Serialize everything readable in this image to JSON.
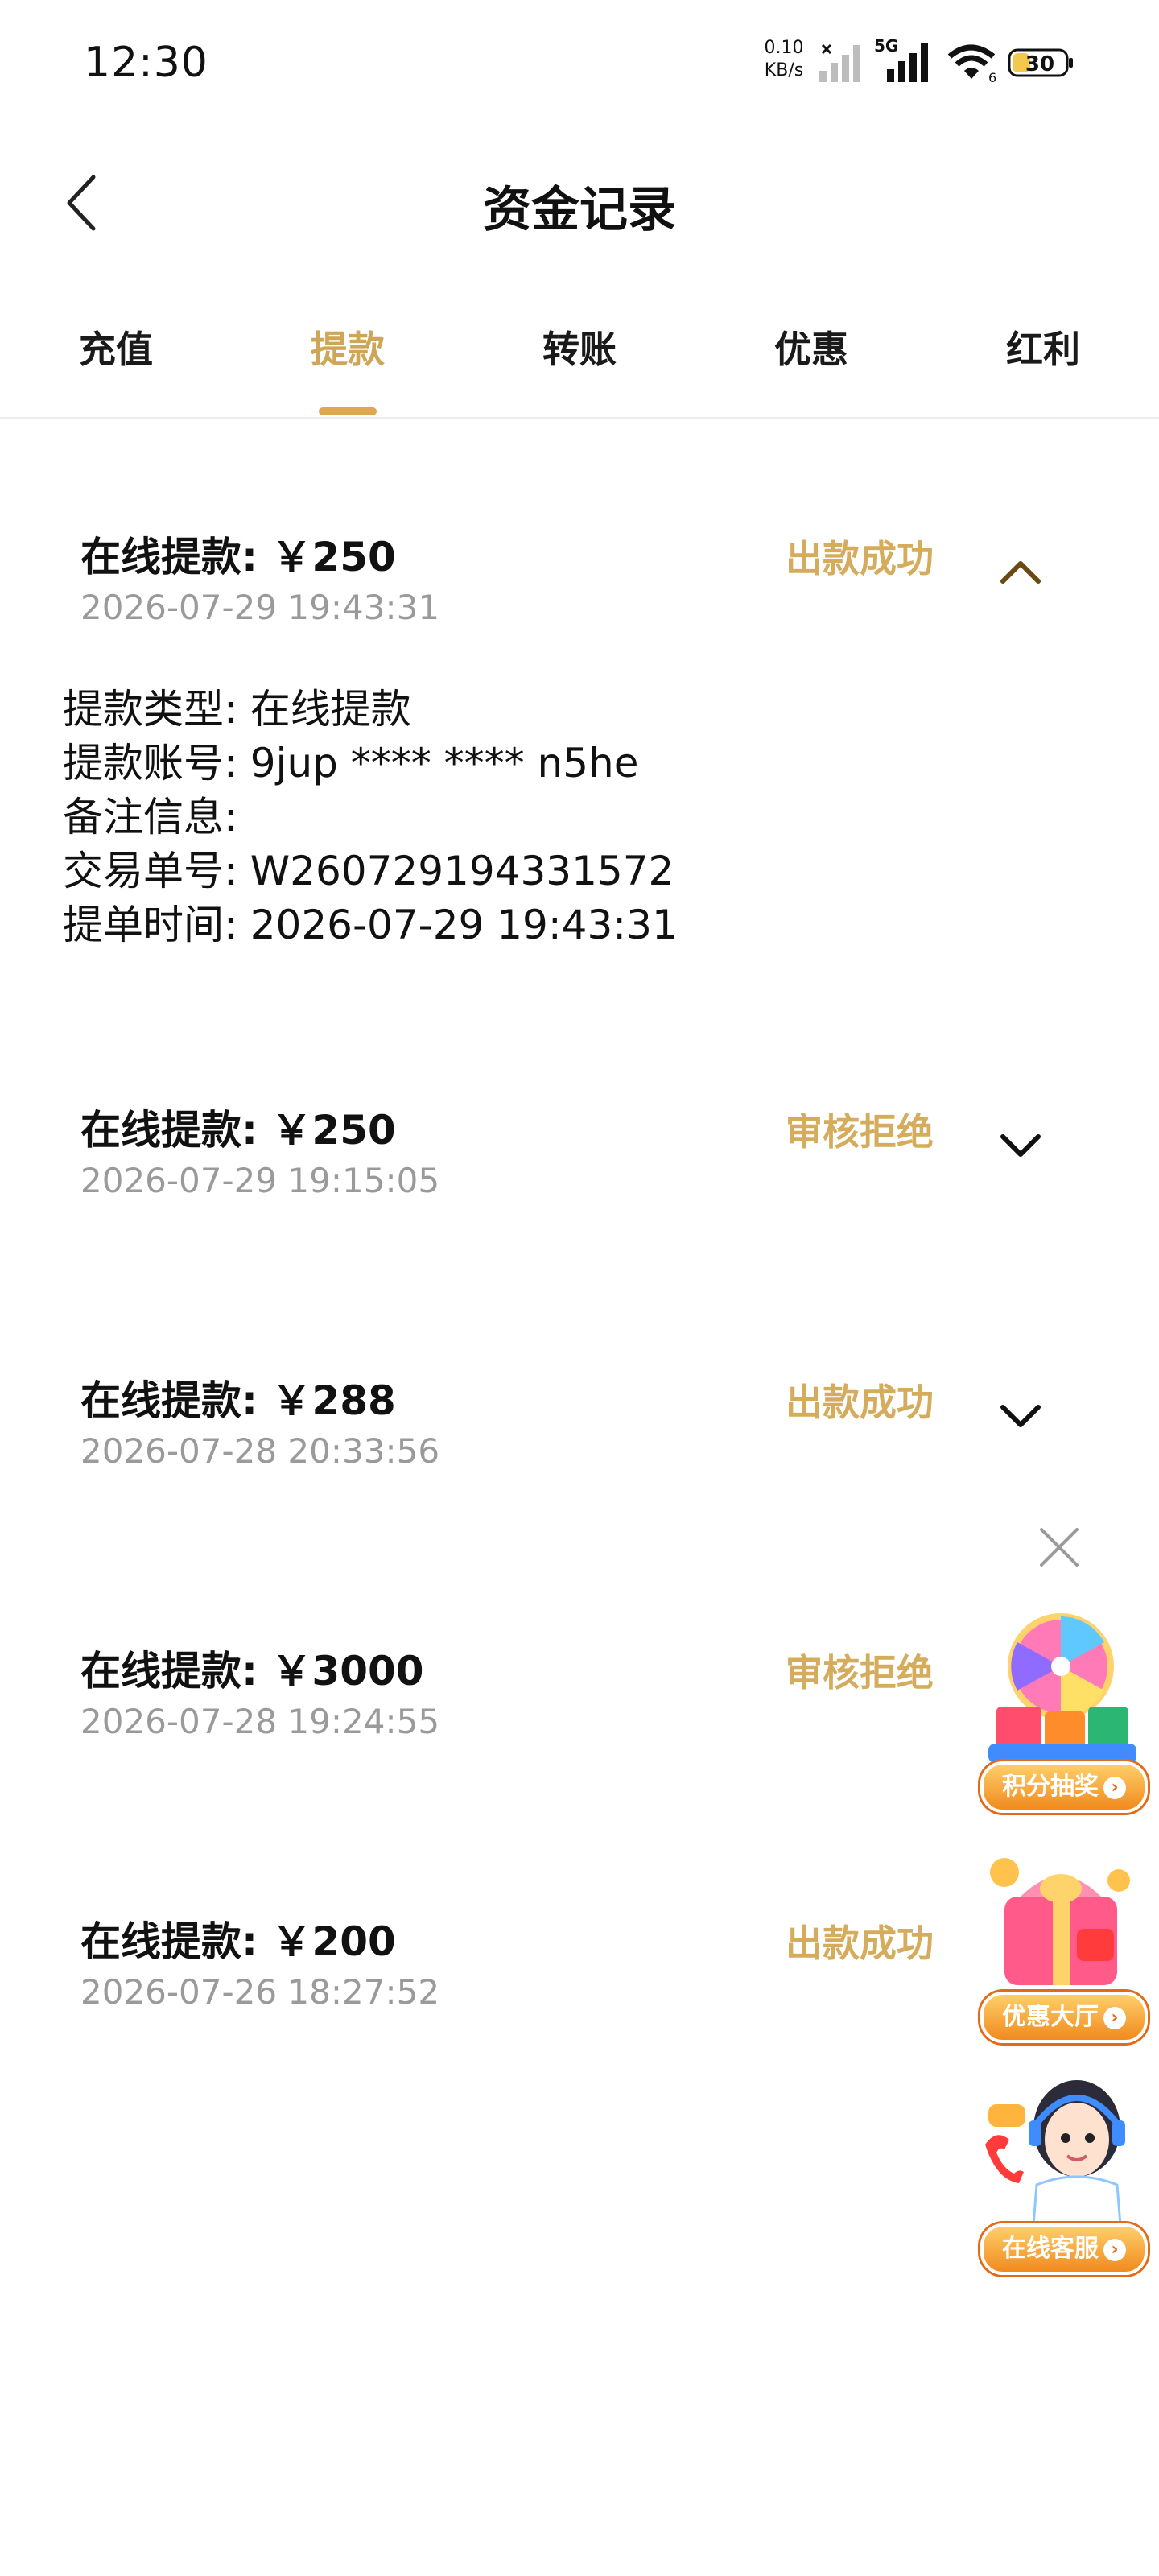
{
  "status_bar": {
    "time": "12:30",
    "net_speed_value": "0.10",
    "net_speed_unit": "KB/s",
    "network_type": "5G",
    "wifi_badge": "6",
    "battery": "30"
  },
  "header": {
    "title": "资金记录",
    "back_icon": "chevron-left-icon"
  },
  "tabs": [
    {
      "label": "充值",
      "active": false
    },
    {
      "label": "提款",
      "active": true
    },
    {
      "label": "转账",
      "active": false
    },
    {
      "label": "优惠",
      "active": false
    },
    {
      "label": "红利",
      "active": false
    }
  ],
  "colors": {
    "accent": "#d4ac5c",
    "tab_active": "#cfa657",
    "underline": "#e0a84e",
    "muted_text": "#9a9a9a"
  },
  "records": [
    {
      "title": "在线提款: ￥250",
      "date": "2026-07-29 19:43:31",
      "status": "出款成功",
      "expanded": true
    },
    {
      "title": "在线提款: ￥250",
      "date": "2026-07-29 19:15:05",
      "status": "审核拒绝",
      "expanded": false
    },
    {
      "title": "在线提款: ￥288",
      "date": "2026-07-28 20:33:56",
      "status": "出款成功",
      "expanded": false
    },
    {
      "title": "在线提款: ￥3000",
      "date": "2026-07-28 19:24:55",
      "status": "审核拒绝",
      "expanded": false
    },
    {
      "title": "在线提款: ￥200",
      "date": "2026-07-26 18:27:52",
      "status": "出款成功",
      "expanded": false
    }
  ],
  "detail": {
    "type": "提款类型: 在线提款",
    "account": "提款账号: 9jup **** **** n5he",
    "remark": "备注信息:",
    "order_no": "交易单号: W260729194331572",
    "time": "提单时间: 2026-07-29 19:43:31"
  },
  "floating": [
    {
      "label": "积分抽奖",
      "icon": "prize-wheel-icon"
    },
    {
      "label": "优惠大厅",
      "icon": "gift-box-icon"
    },
    {
      "label": "在线客服",
      "icon": "customer-service-icon"
    }
  ]
}
